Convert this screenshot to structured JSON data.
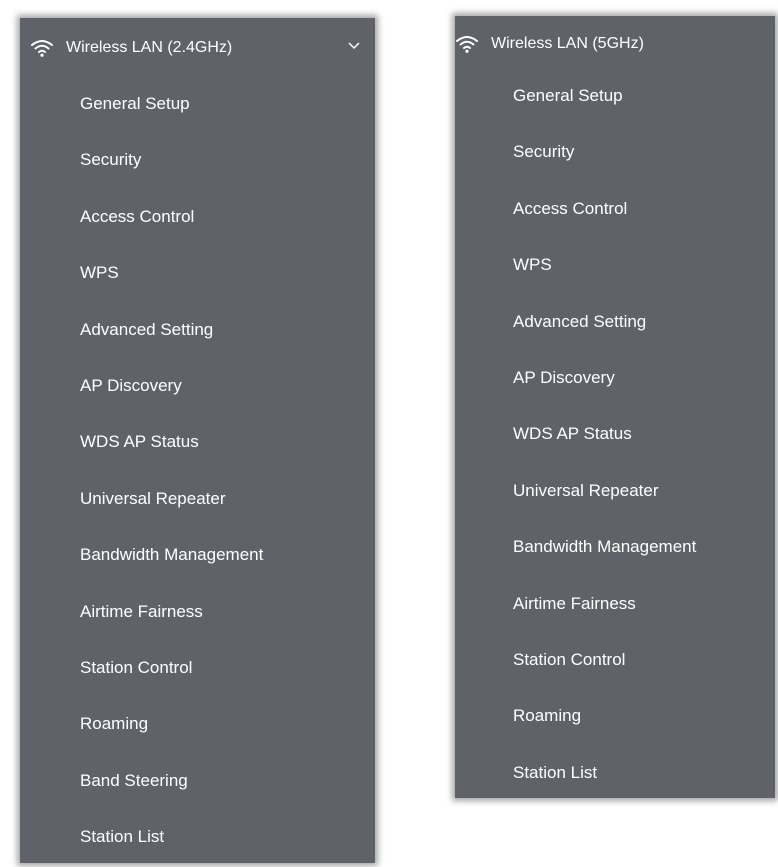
{
  "colors": {
    "panel_bg": "#5f6369",
    "text": "#ffffff"
  },
  "menu_24ghz": {
    "title": "Wireless LAN (2.4GHz)",
    "icon": "wifi-icon",
    "expand_icon": "chevron-down-icon",
    "items": [
      {
        "label": "General Setup"
      },
      {
        "label": "Security"
      },
      {
        "label": "Access Control"
      },
      {
        "label": "WPS"
      },
      {
        "label": "Advanced Setting"
      },
      {
        "label": "AP Discovery"
      },
      {
        "label": "WDS AP Status"
      },
      {
        "label": "Universal Repeater"
      },
      {
        "label": "Bandwidth Management"
      },
      {
        "label": "Airtime Fairness"
      },
      {
        "label": "Station Control"
      },
      {
        "label": "Roaming"
      },
      {
        "label": "Band Steering"
      },
      {
        "label": "Station List"
      }
    ]
  },
  "menu_5ghz": {
    "title": "Wireless LAN (5GHz)",
    "icon": "wifi-icon",
    "items": [
      {
        "label": "General Setup"
      },
      {
        "label": "Security"
      },
      {
        "label": "Access Control"
      },
      {
        "label": "WPS"
      },
      {
        "label": "Advanced Setting"
      },
      {
        "label": "AP Discovery"
      },
      {
        "label": "WDS AP Status"
      },
      {
        "label": "Universal Repeater"
      },
      {
        "label": "Bandwidth Management"
      },
      {
        "label": "Airtime Fairness"
      },
      {
        "label": "Station Control"
      },
      {
        "label": "Roaming"
      },
      {
        "label": "Station List"
      }
    ]
  }
}
